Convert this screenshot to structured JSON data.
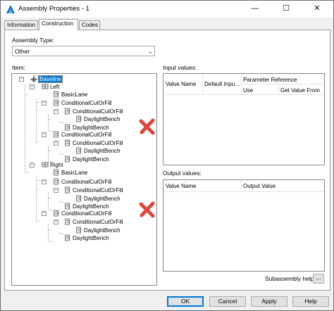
{
  "window": {
    "title": "Assembly Properties - 1"
  },
  "tabs": [
    {
      "label": "Information",
      "active": false
    },
    {
      "label": "Construction",
      "active": true
    },
    {
      "label": "Codes",
      "active": false
    }
  ],
  "assembly_type": {
    "label": "Assembly Type:",
    "value": "Other"
  },
  "tree": {
    "label": "Item:",
    "nodes": [
      {
        "label": "Baseline",
        "icon": "baseline-icon",
        "selected": true
      },
      {
        "label": "Left",
        "icon": "group-icon"
      },
      {
        "label": "BasicLane",
        "icon": "subassembly-icon"
      },
      {
        "label": "ConditionalCutOrFill",
        "icon": "subassembly-icon"
      },
      {
        "label": "ConditionalCutOrFill",
        "icon": "subassembly-icon"
      },
      {
        "label": "DaylightBench",
        "icon": "subassembly-icon"
      },
      {
        "label": "DaylightBench",
        "icon": "subassembly-icon"
      },
      {
        "label": "ConditionalCutOrFill",
        "icon": "subassembly-icon"
      },
      {
        "label": "ConditionalCutOrFill",
        "icon": "subassembly-icon"
      },
      {
        "label": "DaylightBench",
        "icon": "subassembly-icon"
      },
      {
        "label": "DaylightBench",
        "icon": "subassembly-icon"
      },
      {
        "label": "Right",
        "icon": "group-icon"
      },
      {
        "label": "BasicLane",
        "icon": "subassembly-icon"
      },
      {
        "label": "ConditionalCutOrFill",
        "icon": "subassembly-icon"
      },
      {
        "label": "ConditionalCutOrFill",
        "icon": "subassembly-icon"
      },
      {
        "label": "DaylightBench",
        "icon": "subassembly-icon"
      },
      {
        "label": "DaylightBench",
        "icon": "subassembly-icon"
      },
      {
        "label": "ConditionalCutOrFill",
        "icon": "subassembly-icon"
      },
      {
        "label": "ConditionalCutOrFill",
        "icon": "subassembly-icon"
      },
      {
        "label": "DaylightBench",
        "icon": "subassembly-icon"
      },
      {
        "label": "DaylightBench",
        "icon": "subassembly-icon"
      }
    ]
  },
  "input_values": {
    "label": "Input values:",
    "columns": {
      "value_name": "Value Name",
      "default_input": "Default Inpu...",
      "parameter_reference": "Parameter Reference",
      "use": "Use",
      "get_value_from": "Get Value From"
    }
  },
  "output_values": {
    "label": "Output values:",
    "columns": {
      "value_name": "Value Name",
      "output_value": "Output Value"
    }
  },
  "subassembly_help": {
    "label": "Subassembly help:",
    "button": "..."
  },
  "footer": {
    "ok": "OK",
    "cancel": "Cancel",
    "apply": "Apply",
    "help": "Help"
  },
  "colors": {
    "selection": "#0078d7",
    "annotation_x": "#e0443a"
  }
}
